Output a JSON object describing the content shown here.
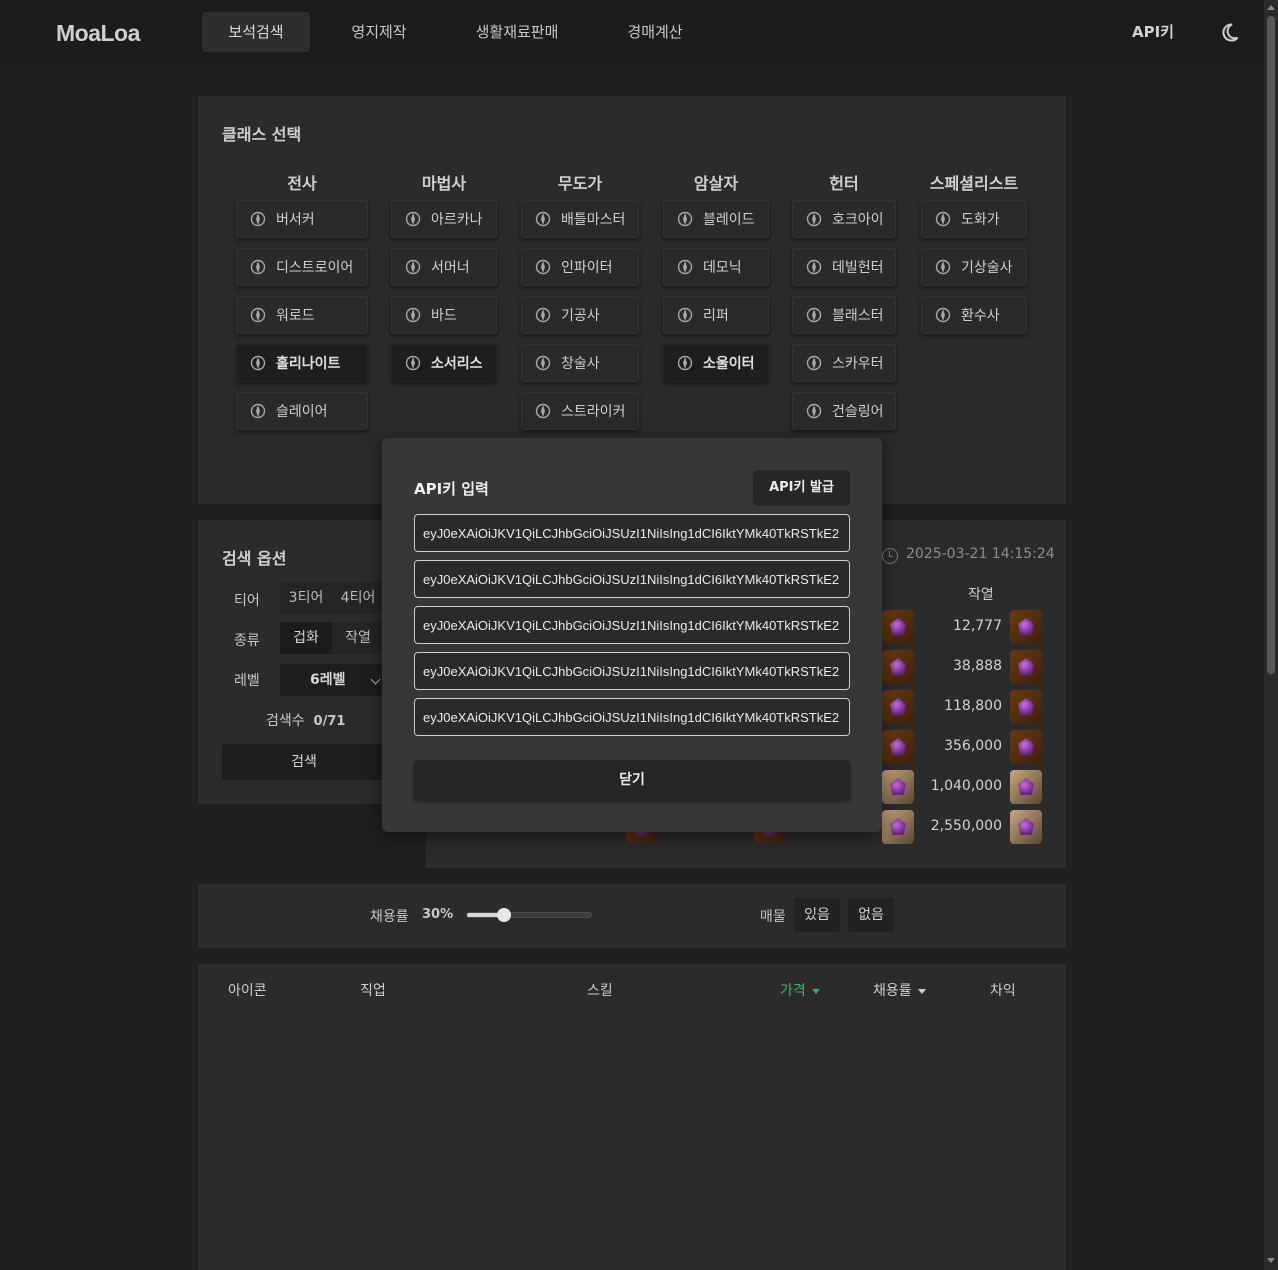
{
  "nav": {
    "logo": "MoaLoa",
    "tabs": [
      "보석검색",
      "영지제작",
      "생활재료판매",
      "경매계산"
    ],
    "api_key_label": "API키",
    "theme_icon": "moon-icon"
  },
  "class_select": {
    "title": "클래스 선택",
    "groups": [
      {
        "name": "전사",
        "classes": [
          "버서커",
          "디스트로이어",
          "워로드",
          "홀리나이트",
          "슬레이어"
        ]
      },
      {
        "name": "마법사",
        "classes": [
          "아르카나",
          "서머너",
          "바드",
          "소서리스"
        ]
      },
      {
        "name": "무도가",
        "classes": [
          "배틀마스터",
          "인파이터",
          "기공사",
          "창술사",
          "스트라이커"
        ]
      },
      {
        "name": "암살자",
        "classes": [
          "블레이드",
          "데모닉",
          "리퍼",
          "소울이터"
        ]
      },
      {
        "name": "헌터",
        "classes": [
          "호크아이",
          "데빌헌터",
          "블래스터",
          "스카우터",
          "건슬링어"
        ]
      },
      {
        "name": "스페셜리스트",
        "classes": [
          "도화가",
          "기상술사",
          "환수사"
        ]
      }
    ],
    "highlighted": [
      "홀리나이트",
      "소서리스",
      "소울이터"
    ]
  },
  "search_options": {
    "title": "검색 옵션",
    "tier_label": "티어",
    "tiers": [
      "3티어",
      "4티어"
    ],
    "type_label": "종류",
    "types": [
      "겁화",
      "작열"
    ],
    "level_label": "레벨",
    "level_value": "6레벨",
    "count_text": "검색수",
    "count_value": "0/71",
    "search_button": "검색"
  },
  "price_table": {
    "timestamp": "2025-03-21 14:15:24",
    "column": "작열",
    "prices": [
      "12,777",
      "38,888",
      "118,800",
      "356,000",
      "1,040,000",
      "2,550,000"
    ]
  },
  "filters": {
    "rate_label": "채용률",
    "rate_value": "30%",
    "rate_fraction": 0.3,
    "stock_label": "매물",
    "stock_options": [
      "있음",
      "없음"
    ]
  },
  "results": {
    "headers": {
      "icon": "아이콘",
      "job": "직업",
      "skill": "스킬",
      "price": "가격",
      "rate": "채용률",
      "diff": "차익"
    },
    "accent": "#3bb26a"
  },
  "modal": {
    "title": "API키 입력",
    "issue_button": "API키 발급",
    "keys": [
      "eyJ0eXAiOiJKV1QiLCJhbGciOiJSUzI1NiIsIng1dCI6IktYMk40TkRSTkE2",
      "eyJ0eXAiOiJKV1QiLCJhbGciOiJSUzI1NiIsIng1dCI6IktYMk40TkRSTkE2",
      "eyJ0eXAiOiJKV1QiLCJhbGciOiJSUzI1NiIsIng1dCI6IktYMk40TkRSTkE2",
      "eyJ0eXAiOiJKV1QiLCJhbGciOiJSUzI1NiIsIng1dCI6IktYMk40TkRSTkE2",
      "eyJ0eXAiOiJKV1QiLCJhbGciOiJSUzI1NiIsIng1dCI6IktYMk40TkRSTkE2"
    ],
    "close_button": "닫기"
  }
}
